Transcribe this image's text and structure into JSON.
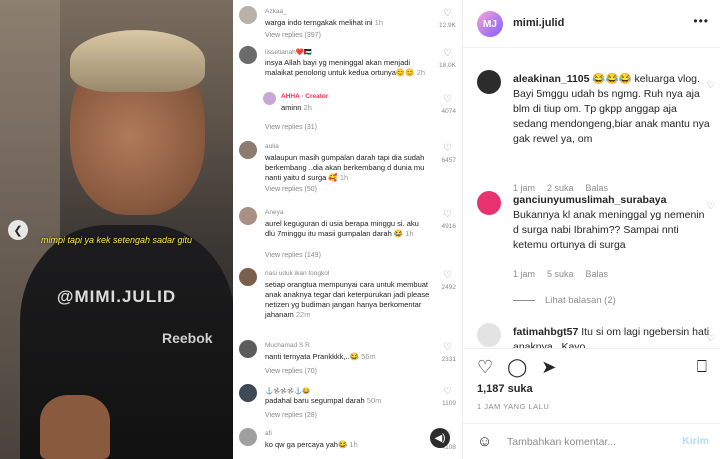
{
  "post_image": {
    "subtitle": "mimpi tapi ya kek setengah sadar gitu",
    "watermark": "@MIMI.JULID",
    "shirt_brand": "Reebok",
    "comments": [
      {
        "user": "Azkaa_",
        "text": "warga indo terngakak melihat ini",
        "time": "1h",
        "replies": "View replies (397)",
        "count": "12,9K"
      },
      {
        "user": "lissetianah❤️🇵🇸",
        "text": "insya Allah bayi yg meninggal akan menjadi malaikat penolong untuk kedua ortunya😊😊",
        "time": "2h",
        "count": "18,0K"
      },
      {
        "user": "AHHA · Creator",
        "text": "aminn",
        "time": "2h",
        "count": "4074"
      },
      {
        "user": "",
        "text": "",
        "time": "",
        "replies": "View replies (31)",
        "count": ""
      },
      {
        "user": "aulia",
        "text": "walaupun masih gumpalan darah tapi dia sudah berkembang ..dia akan berkembang d dunia mu nanti yaitu d surga 🥰",
        "time": "1h",
        "replies": "View replies (50)",
        "count": "6457"
      },
      {
        "user": "Aneya",
        "text": "aurel keguguran di usia berapa minggu si. aku dlu 7minggu itu masii gumpalan darah 😂",
        "time": "1h",
        "replies": "View replies (149)",
        "count": "4916"
      },
      {
        "user": "nasi uduk ikan tongkol",
        "text": "setiap orangtua mempunyai cara untuk membuat anak anaknya tegar dari keterpurukan jadi please netizen yg budiman jangan hanya berkomentar jahanam",
        "time": "22m",
        "count": "2492"
      },
      {
        "user": "Muchamad S R",
        "text": "nanti ternyata Prankkkk,..😂",
        "time": "56m",
        "replies": "View replies (70)",
        "count": "2331"
      },
      {
        "user": "⚓️𖣘𖣘𖣘⚓️😂",
        "text": "padahal baru segumpal darah",
        "time": "50m",
        "replies": "View replies (28)",
        "count": "1109"
      },
      {
        "user": "afi",
        "text": "ko qw ga percaya yah😂",
        "time": "1h",
        "count": "4108"
      }
    ]
  },
  "panel": {
    "account": "mimi.julid",
    "avatar_initials": "MJ",
    "comments": [
      {
        "user": "aleakinan_1105",
        "text": "😂😂😂 keluarga vlog. Bayi 5mggu udah bs ngmg. Ruh nya aja blm di tiup om. Tp gkpp anggap aja sedang mendongeng,biar anak mantu nya gak rewel ya, om",
        "time": "1 jam",
        "likes": "2 suka",
        "reply": "Balas"
      },
      {
        "user": "ganciunyumuslimah_surabaya",
        "text": "Bukannya kl anak meninggal yg nemenin d surga nabi Ibrahim?? Sampai nnti ketemu ortunya di surga",
        "time": "1 jam",
        "likes": "5 suka",
        "reply": "Balas"
      },
      {
        "user": "fatimahbgt57",
        "text": "Itu si om lagi ngebersin hati anaknya.. Kayo",
        "time": "",
        "likes": "",
        "reply": ""
      }
    ],
    "view_replies": "Lihat balasan (2)",
    "likes": "1,187 suka",
    "time_ago": "1 JAM YANG LALU",
    "comment_placeholder": "Tambahkan komentar...",
    "send_label": "Kirim"
  }
}
